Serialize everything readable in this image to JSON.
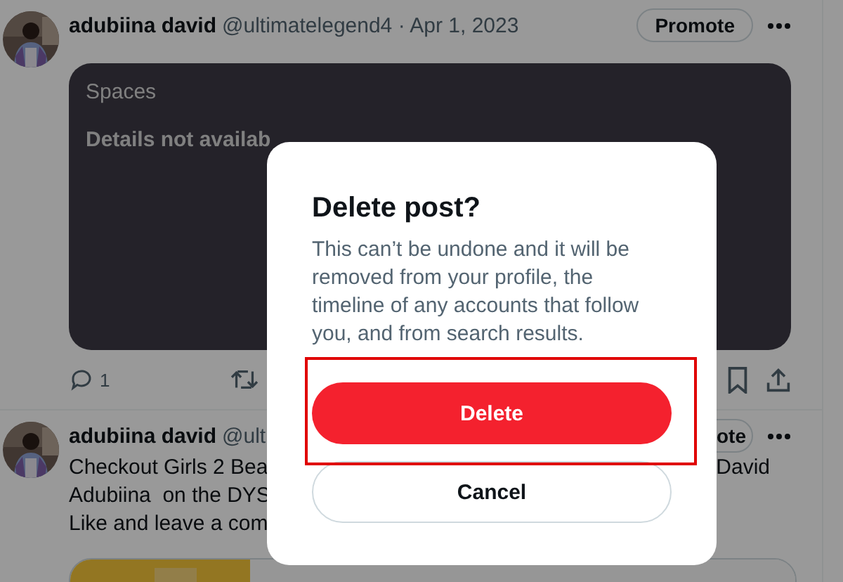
{
  "posts": [
    {
      "author": "adubiina david",
      "handle": "@ultimatelegend4 · Apr 1, 2023",
      "promote": "Promote",
      "card": {
        "title": "Spaces",
        "body": "Details not availab"
      },
      "actions": {
        "reply_count": "1"
      }
    },
    {
      "author": "adubiina david",
      "handle": "@ult",
      "promote": "ote",
      "lines": [
        {
          "left": "Checkout Girls 2 Bea",
          "right": "David"
        },
        {
          "left": "Adubiina  on the DYS"
        },
        {
          "left": "Like and leave a com"
        }
      ]
    }
  ],
  "dialog": {
    "title": "Delete post?",
    "message": "This can’t be undone and it will be removed from your profile, the timeline of any accounts that follow you, and from search results.",
    "buttons": [
      {
        "label": "Delete",
        "kind": "danger"
      },
      {
        "label": "Cancel",
        "kind": "plain"
      }
    ],
    "highlighted": true
  }
}
